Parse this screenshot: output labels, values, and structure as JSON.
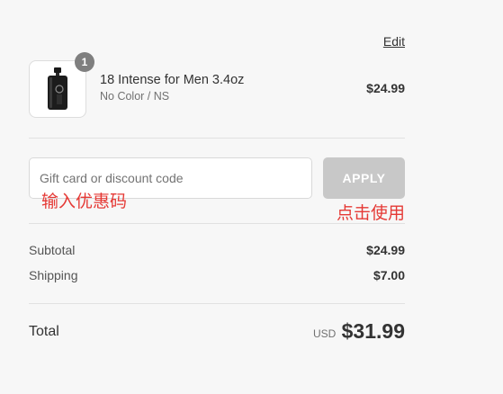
{
  "header": {
    "edit_label": "Edit"
  },
  "product": {
    "quantity": "1",
    "name": "18 Intense for Men 3.4oz",
    "variant": "No Color / NS",
    "price": "$24.99",
    "image_icon": "perfume-bottle-icon"
  },
  "discount": {
    "placeholder": "Gift card or discount code",
    "value": "",
    "apply_label": "APPLY",
    "input_hint": "输入优惠码",
    "button_hint": "点击使用"
  },
  "summary": {
    "subtotal_label": "Subtotal",
    "subtotal_value": "$24.99",
    "shipping_label": "Shipping",
    "shipping_value": "$7.00",
    "total_label": "Total",
    "total_currency": "USD",
    "total_value": "$31.99"
  },
  "colors": {
    "background": "#f7f7f7",
    "apply_button_disabled": "#c8c8c8",
    "annotation_red": "#e53935",
    "badge_gray": "#7f7f7f"
  }
}
